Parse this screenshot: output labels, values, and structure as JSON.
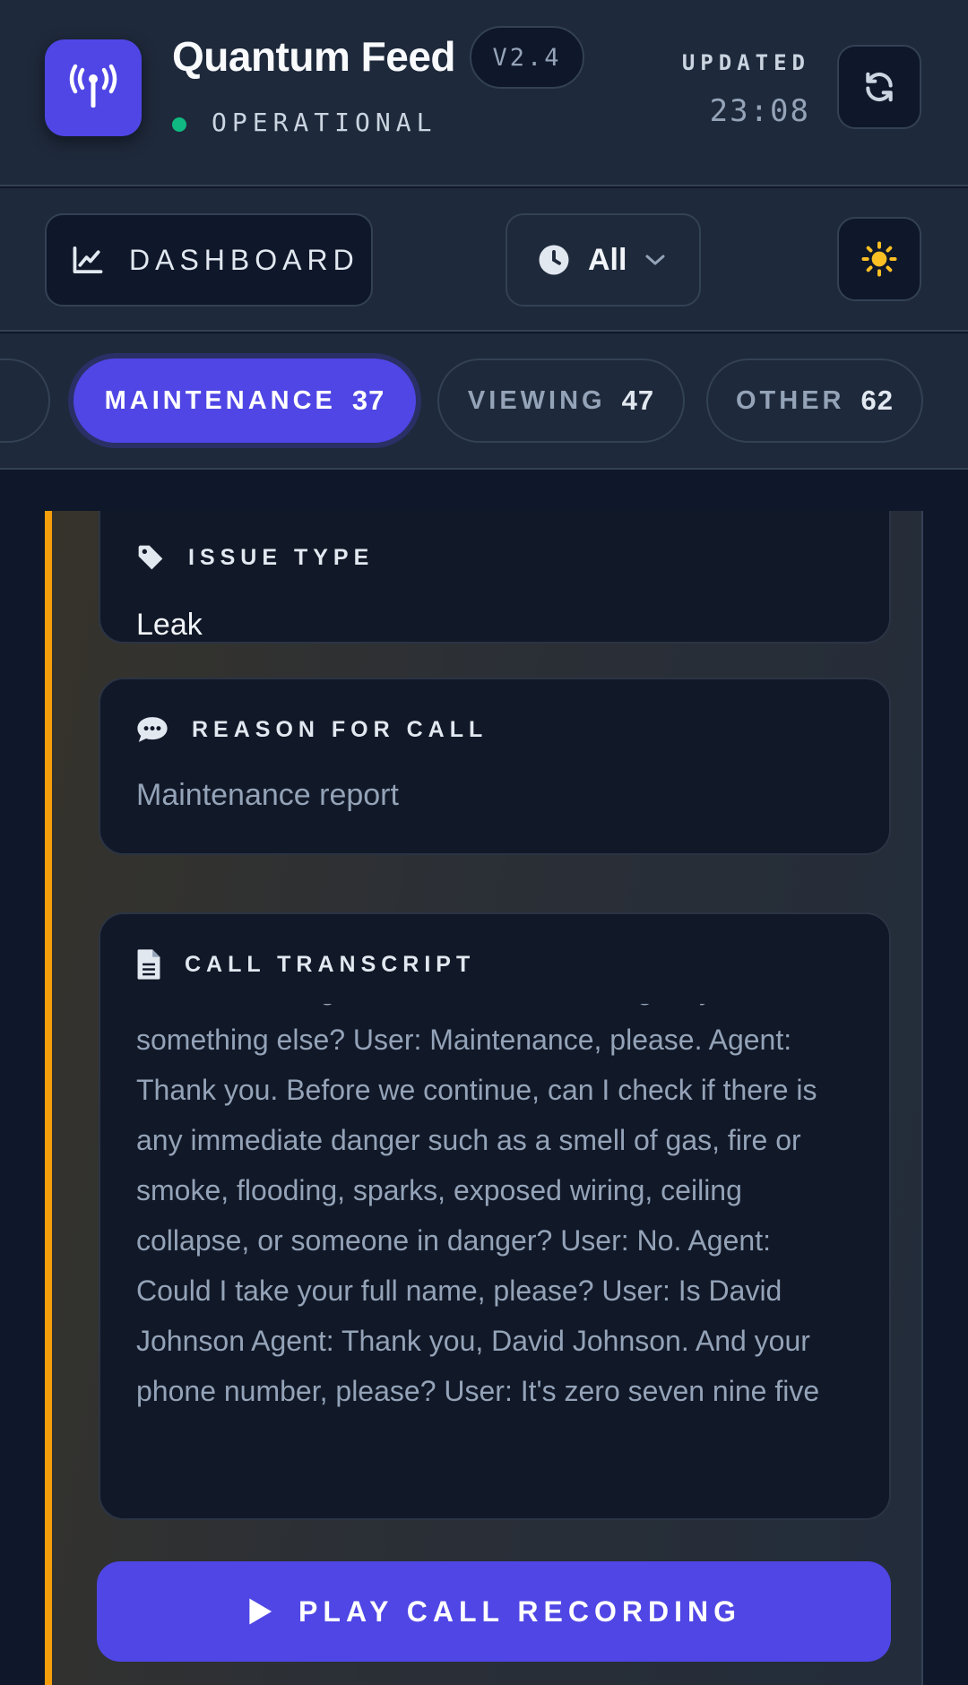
{
  "header": {
    "app_title": "Quantum Feed",
    "version": "V2.4",
    "status": "OPERATIONAL",
    "status_color": "#10b981",
    "updated_label": "UPDATED",
    "updated_time": "23:08",
    "logo_icon": "broadcast-antenna-icon",
    "refresh_icon": "refresh-icon"
  },
  "toolbar": {
    "dashboard_label": "DASHBOARD",
    "dashboard_icon": "line-chart-icon",
    "filter_value": "All",
    "filter_icon": "clock-icon",
    "theme_icon": "sun-icon"
  },
  "tabs": [
    {
      "label": "MAINTENANCE",
      "count": "37",
      "active": true
    },
    {
      "label": "VIEWING",
      "count": "47",
      "active": false
    },
    {
      "label": "OTHER",
      "count": "62",
      "active": false
    }
  ],
  "card": {
    "accent_color": "#f59e0b",
    "issue_type": {
      "label": "ISSUE TYPE",
      "value": "Leak",
      "icon": "tag-icon"
    },
    "reason": {
      "label": "REASON FOR CALL",
      "value": "Maintenance report",
      "icon": "chat-bubble-icon"
    },
    "transcript": {
      "label": "CALL TRANSCRIPT",
      "icon": "document-icon",
      "text": "about a viewing, maintenance, an emergency, or something else? User: Maintenance, please. Agent: Thank you. Before we continue, can I check if there is any immediate danger such as a smell of gas, fire or smoke, flooding, sparks, exposed wiring, ceiling collapse, or someone in danger? User: No. Agent: Could I take your full name, please? User: Is David Johnson Agent: Thank you, David Johnson. And your phone number, please? User: It's zero seven nine five"
    },
    "play_label": "PLAY CALL RECORDING",
    "play_icon": "play-icon"
  },
  "colors": {
    "accent": "#4f46e5",
    "background": "#0f172a",
    "panel": "#1e293b",
    "warning_bar": "#f59e0b",
    "sun": "#fbbf24"
  }
}
